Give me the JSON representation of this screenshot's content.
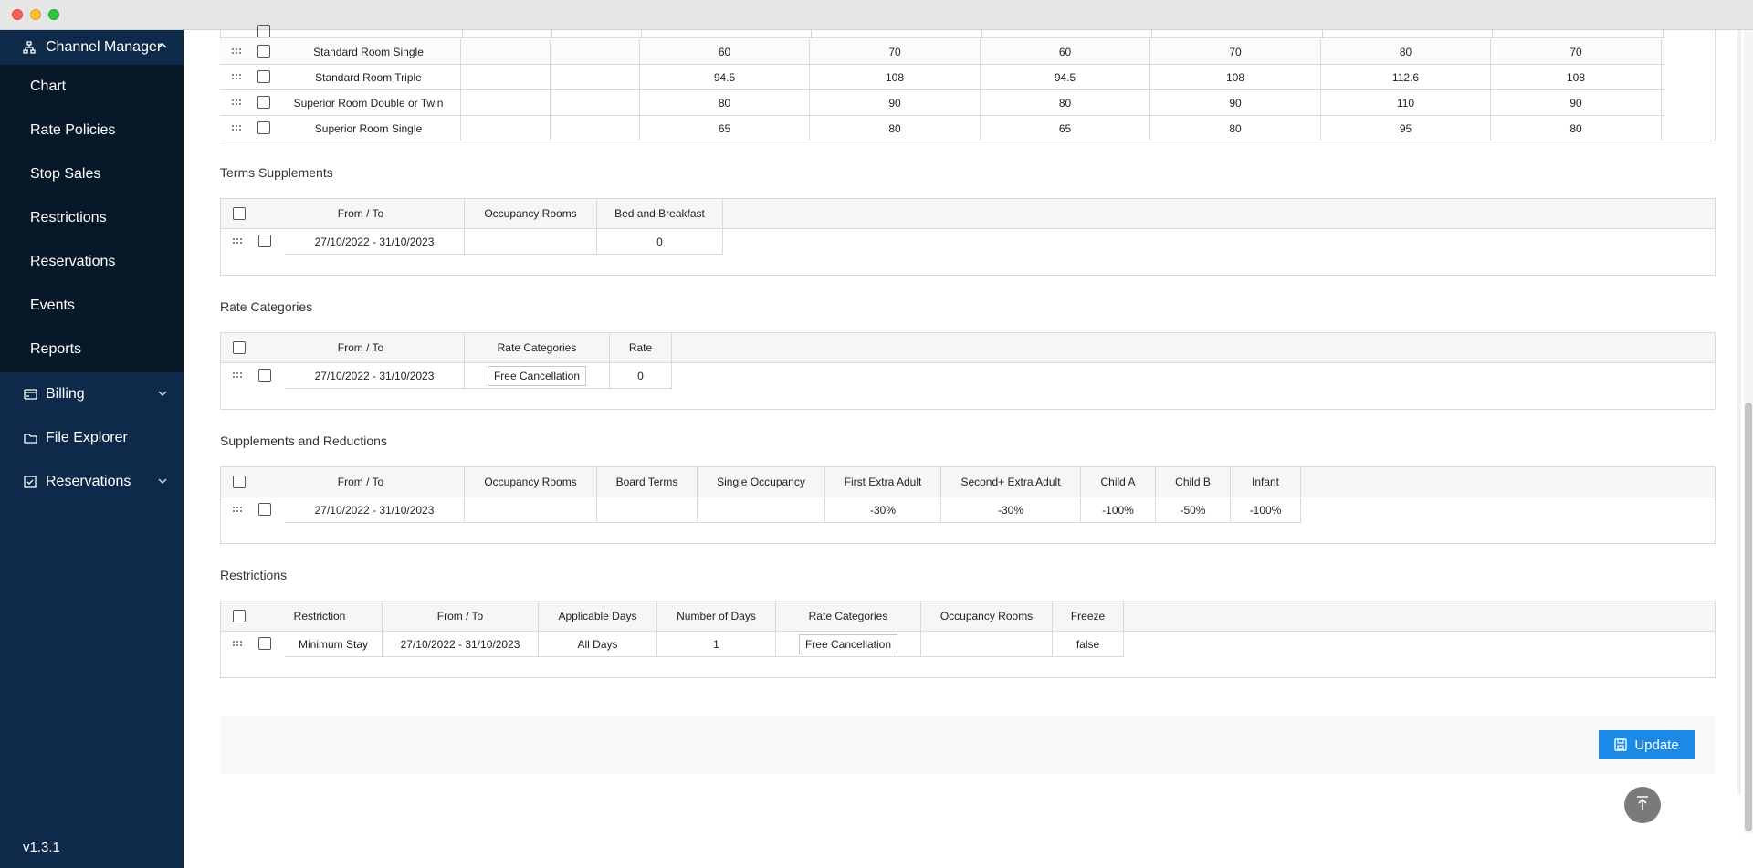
{
  "sidebar": {
    "channel_manager": "Channel Manager",
    "sub_items": [
      "Chart",
      "Rate Policies",
      "Stop Sales",
      "Restrictions",
      "Reservations",
      "Events",
      "Reports"
    ],
    "billing": "Billing",
    "file_explorer": "File Explorer",
    "reservations": "Reservations",
    "version": "v1.3.1"
  },
  "rates_table": {
    "rows": [
      {
        "room": "Standard Room Single",
        "values": [
          "60",
          "70",
          "60",
          "70",
          "80",
          "70"
        ]
      },
      {
        "room": "Standard Room Triple",
        "values": [
          "94.5",
          "108",
          "94.5",
          "108",
          "112.6",
          "108"
        ]
      },
      {
        "room": "Superior Room Double or Twin",
        "values": [
          "80",
          "90",
          "80",
          "90",
          "110",
          "90"
        ]
      },
      {
        "room": "Superior Room Single",
        "values": [
          "65",
          "80",
          "65",
          "80",
          "95",
          "80"
        ]
      }
    ]
  },
  "terms_supplements": {
    "title": "Terms Supplements",
    "headers": [
      "From / To",
      "Occupancy Rooms",
      "Bed and Breakfast"
    ],
    "row": {
      "from_to": "27/10/2022 - 31/10/2023",
      "occupancy": "",
      "bed_breakfast": "0"
    }
  },
  "rate_categories": {
    "title": "Rate Categories",
    "headers": [
      "From / To",
      "Rate Categories",
      "Rate"
    ],
    "row": {
      "from_to": "27/10/2022 - 31/10/2023",
      "category": "Free Cancellation",
      "rate": "0"
    }
  },
  "supplements": {
    "title": "Supplements and Reductions",
    "headers": [
      "From / To",
      "Occupancy Rooms",
      "Board Terms",
      "Single Occupancy",
      "First Extra Adult",
      "Second+ Extra Adult",
      "Child A",
      "Child B",
      "Infant"
    ],
    "row": {
      "from_to": "27/10/2022 - 31/10/2023",
      "occupancy": "",
      "board": "",
      "single": "",
      "first_adult": "-30%",
      "second_adult": "-30%",
      "child_a": "-100%",
      "child_b": "-50%",
      "infant": "-100%"
    }
  },
  "restrictions": {
    "title": "Restrictions",
    "headers": [
      "Restriction",
      "From / To",
      "Applicable Days",
      "Number of Days",
      "Rate Categories",
      "Occupancy Rooms",
      "Freeze"
    ],
    "row": {
      "restriction": "Minimum Stay",
      "from_to": "27/10/2022 - 31/10/2023",
      "days": "All Days",
      "num_days": "1",
      "category": "Free Cancellation",
      "occupancy": "",
      "freeze": "false"
    }
  },
  "update_label": "Update"
}
